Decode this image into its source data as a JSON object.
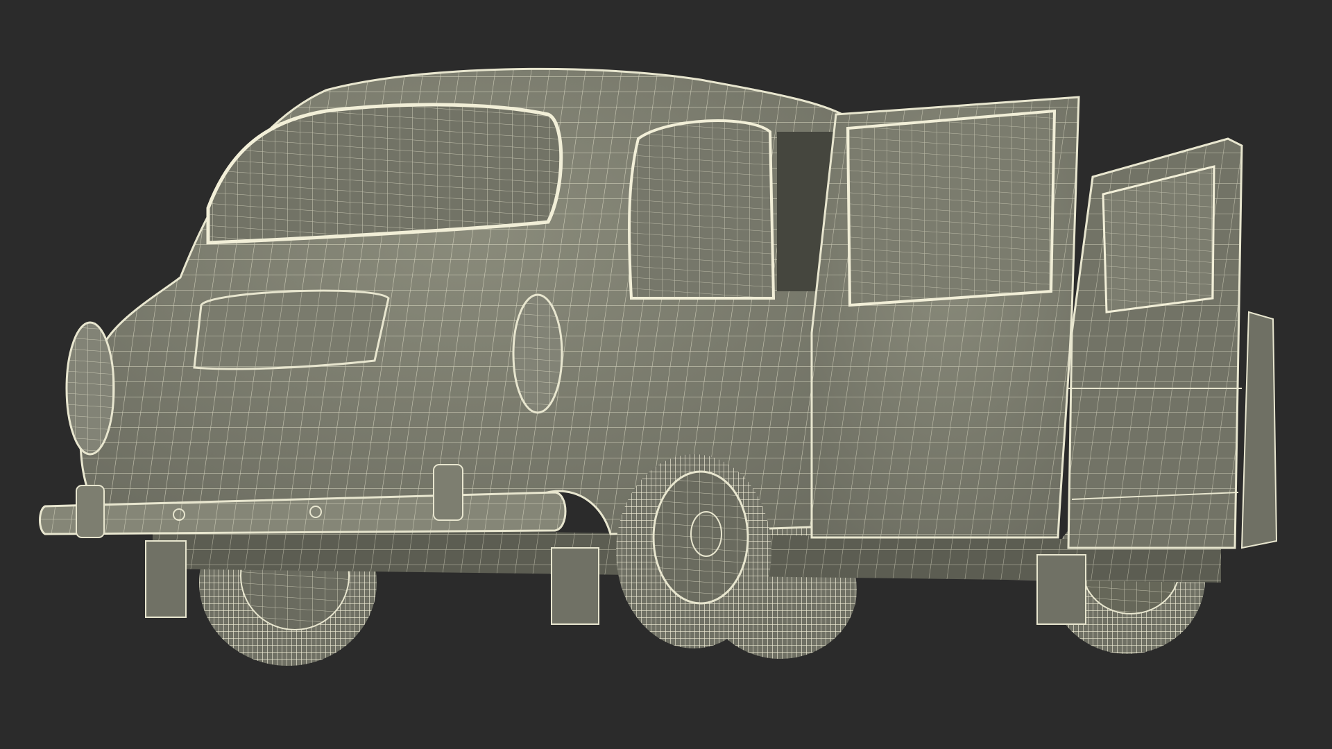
{
  "scene": {
    "background_color": "#2b2b2b",
    "model_fill_color": "#7d7e6f",
    "model_shadow_color": "#5c5d52",
    "wire_color": "#e8e6cf",
    "subject": "wireframe-vintage-car-doors-open"
  }
}
